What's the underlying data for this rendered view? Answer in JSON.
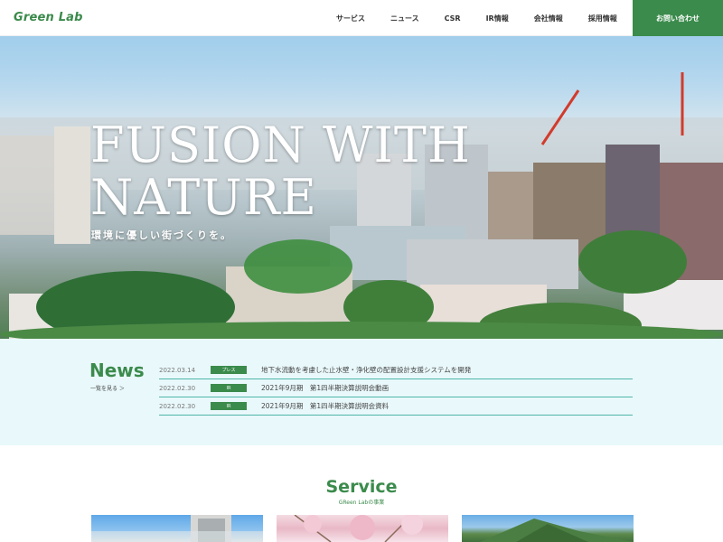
{
  "header": {
    "logo": "Green Lab",
    "nav": [
      "サービス",
      "ニュース",
      "CSR",
      "IR情報",
      "会社情報",
      "採用情報"
    ],
    "contact": "お問い合わせ"
  },
  "hero": {
    "title": "FUSION WITH\nNATURE",
    "subtitle": "環境に優しい街づくりを。"
  },
  "news": {
    "title": "News",
    "more": "一覧を見る ＞",
    "items": [
      {
        "date": "2022.03.14",
        "tag": "プレス",
        "text": "地下水流動を考慮した止水壁・浄化壁の配置設計支援システムを開発"
      },
      {
        "date": "2022.02.30",
        "tag": "IR",
        "text": "2021年9月期　第1四半期決算説明会動画"
      },
      {
        "date": "2022.02.30",
        "tag": "IR",
        "text": "2021年9月期　第1四半期決算説明会資料"
      }
    ]
  },
  "service": {
    "title": "Service",
    "subtitle": "GReen Labの事業"
  },
  "colors": {
    "brand": "#3b8b4c",
    "news_bg": "#e9f8fb",
    "divider": "#4fb7a7"
  }
}
